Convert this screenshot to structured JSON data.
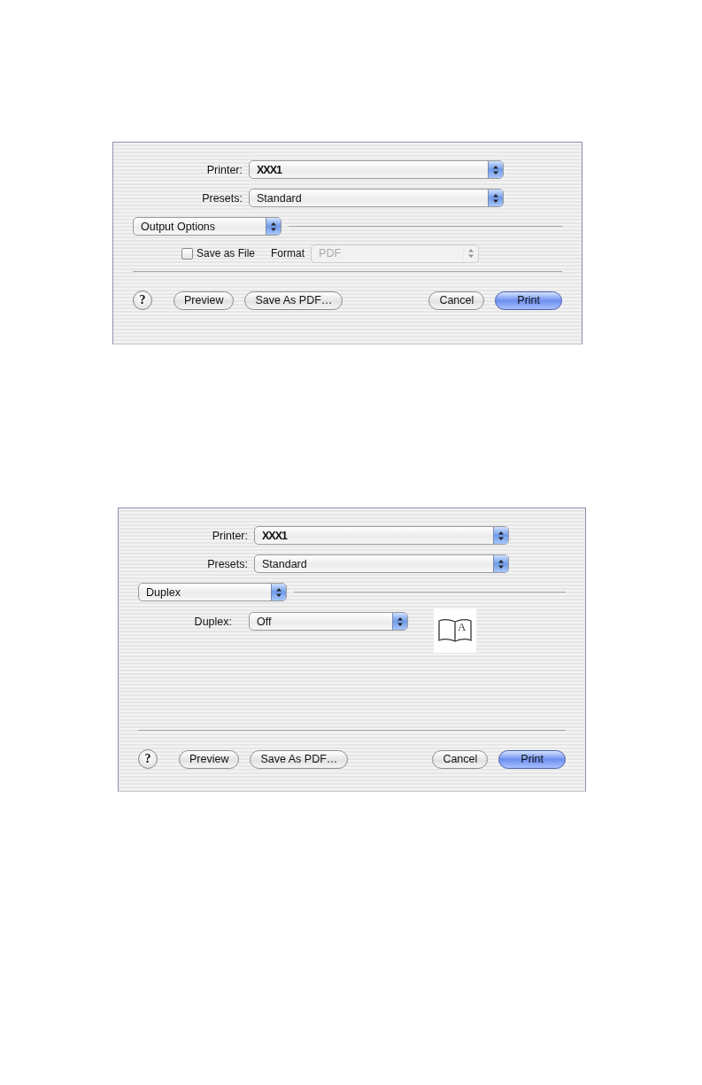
{
  "dialogs": [
    {
      "printer": {
        "label": "Printer:",
        "value": "XXX1"
      },
      "presets": {
        "label": "Presets:",
        "value": "Standard"
      },
      "panel_menu": "Output Options",
      "panel": {
        "kind": "output_options",
        "save_as_file": {
          "label": "Save as File",
          "checked": false
        },
        "format": {
          "label": "Format",
          "value": "PDF",
          "disabled": true
        }
      },
      "help": "?",
      "buttons": [
        {
          "label": "Preview",
          "default": false
        },
        {
          "label": "Save As PDF…",
          "default": false
        },
        {
          "label": "Cancel",
          "default": false
        },
        {
          "label": "Print",
          "default": true
        }
      ]
    },
    {
      "printer": {
        "label": "Printer:",
        "value": "XXX1"
      },
      "presets": {
        "label": "Presets:",
        "value": "Standard"
      },
      "panel_menu": "Duplex",
      "panel": {
        "kind": "duplex",
        "duplex": {
          "label": "Duplex:",
          "value": "Off"
        },
        "preview_letter": "A"
      },
      "help": "?",
      "buttons": [
        {
          "label": "Preview",
          "default": false
        },
        {
          "label": "Save As PDF…",
          "default": false
        },
        {
          "label": "Cancel",
          "default": false
        },
        {
          "label": "Print",
          "default": true
        }
      ]
    }
  ]
}
